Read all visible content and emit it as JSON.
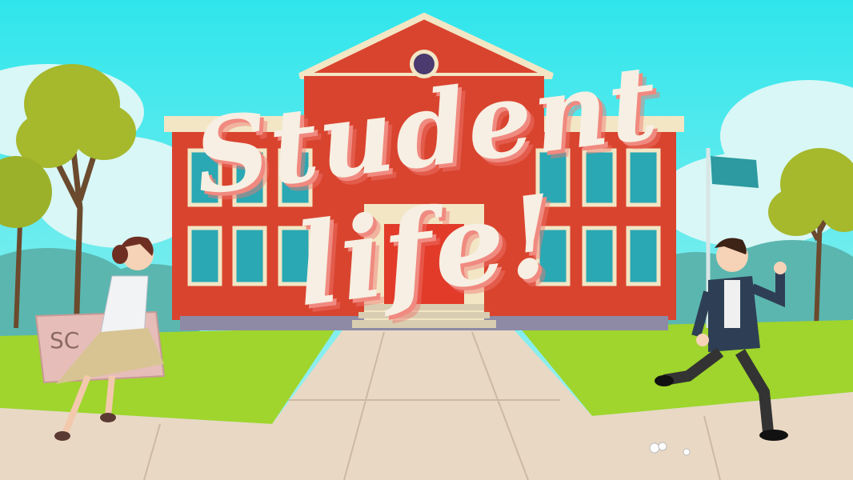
{
  "scene": {
    "title_line1": "Student",
    "title_line2": "life!",
    "sign_text": "SC",
    "colors": {
      "sky": "#3ee8ea",
      "brick": "#d9442f",
      "grass": "#9fd52c",
      "path": "#e9d8c4",
      "title": "#f7efe3",
      "title_shadow": "#f08a80"
    }
  }
}
